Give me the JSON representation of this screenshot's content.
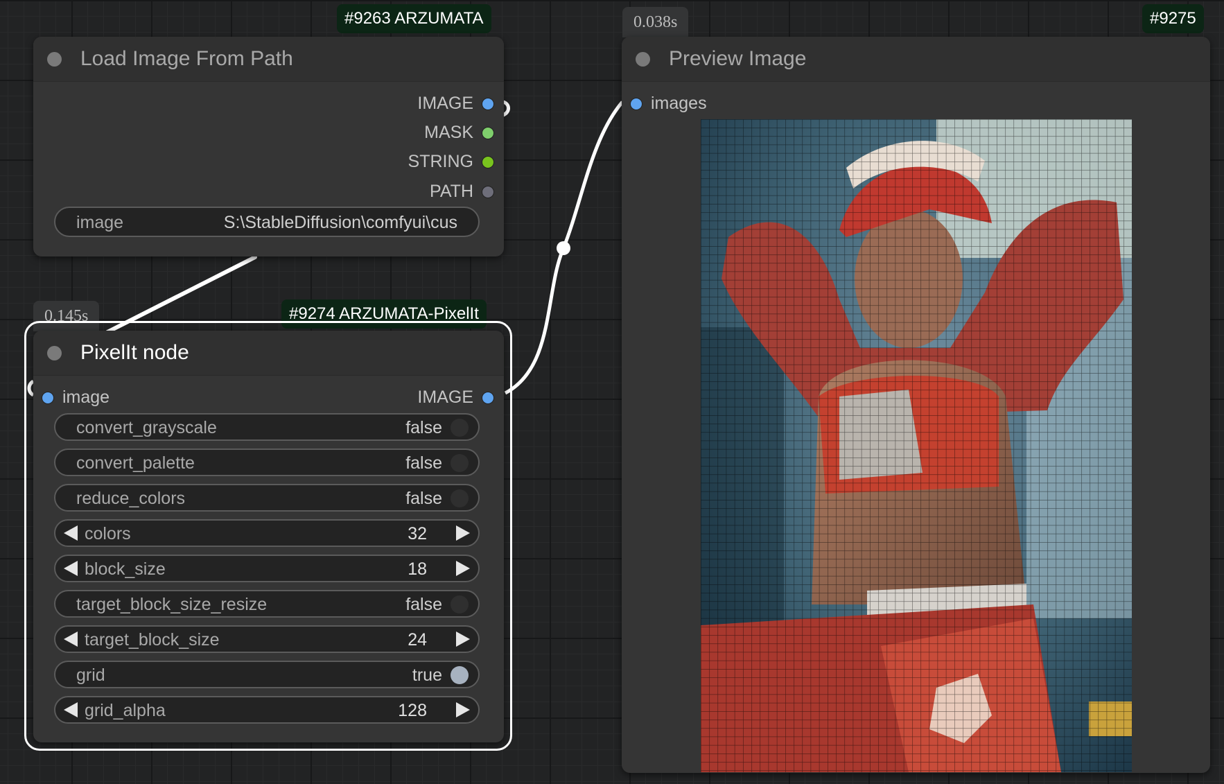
{
  "colors": {
    "image_slot": "#5fa4f0",
    "mask_slot": "#7fcf6c",
    "string_slot": "#79c41e",
    "path_slot": "#6e6e7a",
    "badge_bg": "#0c2515",
    "selection": "#ffffff"
  },
  "load_node": {
    "badge": "#9263 ARZUMATA",
    "title": "Load Image From Path",
    "outputs": [
      "IMAGE",
      "MASK",
      "STRING",
      "PATH"
    ],
    "widget": {
      "label": "image",
      "value": "S:\\StableDiffusion\\comfyui\\cus"
    }
  },
  "pixel_node": {
    "time": "0.145s",
    "badge": "#9274 ARZUMATA-PixelIt",
    "title": "PixelIt node",
    "input": "image",
    "output": "IMAGE",
    "widgets": [
      {
        "label": "convert_grayscale",
        "value": "false",
        "kind": "toggle"
      },
      {
        "label": "convert_palette",
        "value": "false",
        "kind": "toggle"
      },
      {
        "label": "reduce_colors",
        "value": "false",
        "kind": "toggle"
      },
      {
        "label": "colors",
        "value": "32",
        "kind": "number"
      },
      {
        "label": "block_size",
        "value": "18",
        "kind": "number"
      },
      {
        "label": "target_block_size_resize",
        "value": "false",
        "kind": "toggle"
      },
      {
        "label": "target_block_size",
        "value": "24",
        "kind": "number"
      },
      {
        "label": "grid",
        "value": "true",
        "kind": "toggle"
      },
      {
        "label": "grid_alpha",
        "value": "128",
        "kind": "number"
      }
    ]
  },
  "preview_node": {
    "time": "0.038s",
    "badge": "#9275",
    "title": "Preview Image",
    "input": "images"
  }
}
